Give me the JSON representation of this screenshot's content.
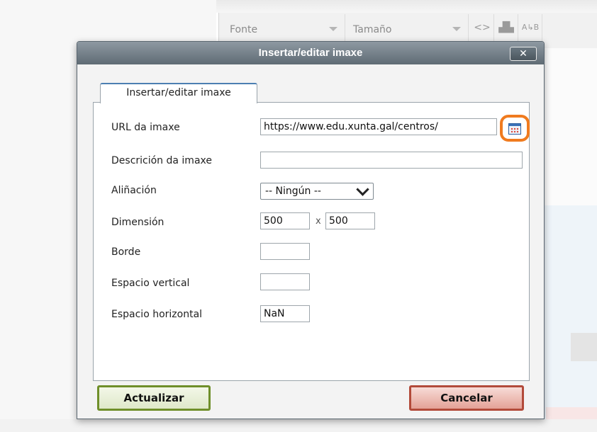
{
  "toolbar": {
    "font_select": "Fonte",
    "size_select": "Tamaño",
    "code_icon": "code-icon",
    "binoculars_icon": "binoculars-icon",
    "replace_icon": "replace-icon"
  },
  "dialog": {
    "title": "Insertar/editar imaxe",
    "close_label": "✕",
    "tab_label": "Insertar/editar imaxe",
    "fields": {
      "url_label": "URL da imaxe",
      "url_value": "https://www.edu.xunta.gal/centros/",
      "description_label": "Descrición da imaxe",
      "description_value": "",
      "alignment_label": "Aliñación",
      "alignment_value": "-- Ningún --",
      "dimension_label": "Dimensión",
      "width_value": "500",
      "dimension_separator": "x",
      "height_value": "500",
      "border_label": "Borde",
      "border_value": "",
      "vspace_label": "Espacio vertical",
      "vspace_value": "",
      "hspace_label": "Espacio horizontal",
      "hspace_value": "NaN"
    },
    "buttons": {
      "update": "Actualizar",
      "cancel": "Cancelar"
    }
  },
  "colors": {
    "highlight": "#f07b1f",
    "update_border": "#6f8f2a",
    "cancel_border": "#b24a3a",
    "titlebar": "#6b7780"
  }
}
